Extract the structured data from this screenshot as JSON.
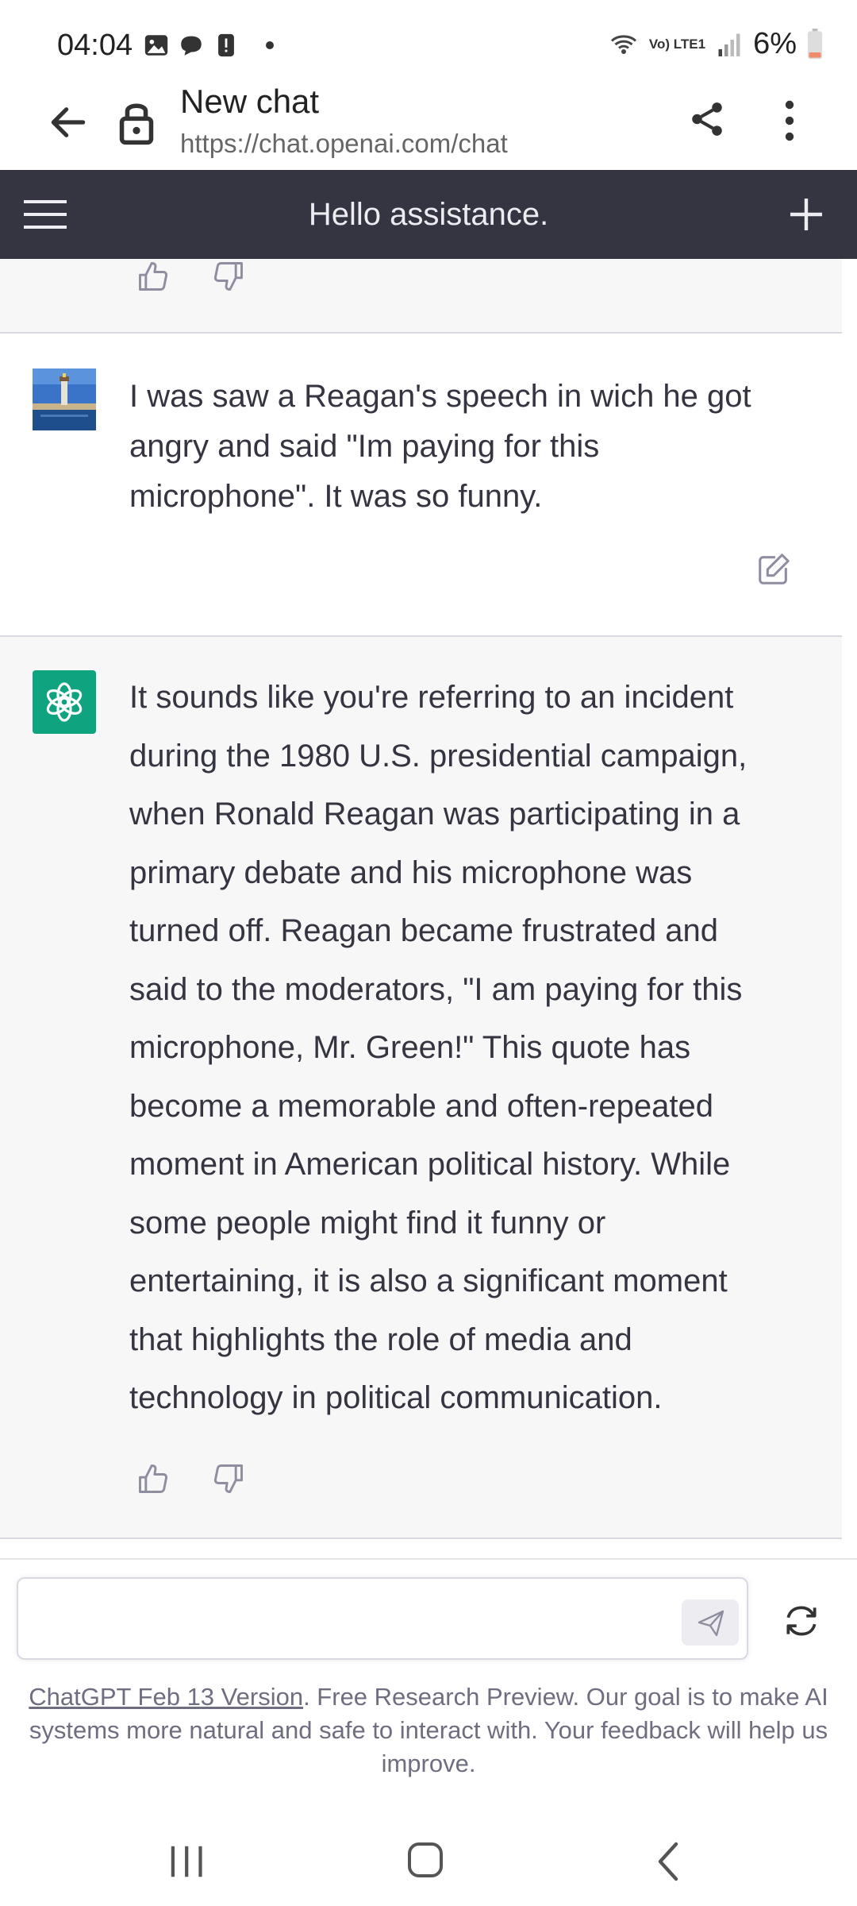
{
  "status_bar": {
    "time": "04:04",
    "battery": "6%",
    "network_label": "Vo) LTE1",
    "icons": [
      "image-icon",
      "chat-bubble-icon",
      "alert-icon",
      "wifi-icon",
      "signal-icon",
      "battery-icon"
    ]
  },
  "browser": {
    "title": "New chat",
    "url": "https://chat.openai.com/chat"
  },
  "header": {
    "title": "Hello assistance."
  },
  "messages": [
    {
      "role": "user",
      "text": "I was saw a Reagan's speech in wich he got angry and said \"Im paying for this microphone\". It was so funny."
    },
    {
      "role": "assistant",
      "text": "It sounds like you're referring to an incident during the 1980 U.S. presidential campaign, when Ronald Reagan was participating in a primary debate and his microphone was turned off. Reagan became frustrated and said to the moderators, \"I am paying for this microphone, Mr. Green!\" This quote has become a memorable and often-repeated moment in American political history. While some people might find it funny or entertaining, it is also a significant moment that highlights the role of media and technology in political communication."
    }
  ],
  "composer": {
    "value": "",
    "placeholder": ""
  },
  "footer": {
    "link_text": "ChatGPT Feb 13 Version",
    "text": ". Free Research Preview. Our goal is to make AI systems more natural and safe to interact with. Your feedback will help us improve."
  },
  "colors": {
    "header_bg": "#343541",
    "assistant_bg": "#f7f7f8",
    "brand_green": "#10a37f"
  }
}
